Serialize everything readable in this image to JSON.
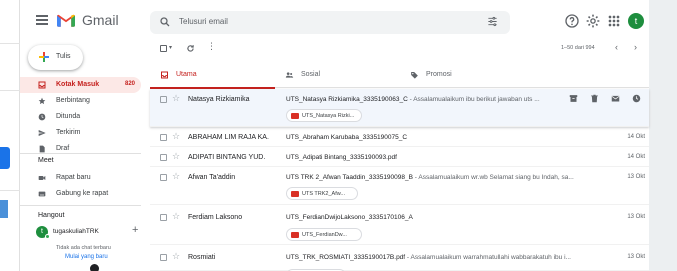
{
  "header": {
    "app_name": "Gmail",
    "search_placeholder": "Telusuri email",
    "avatar_letter": "t",
    "colors": {
      "avatar": "#1e8e3e",
      "accent": "#c5221f"
    }
  },
  "sidebar": {
    "compose_label": "Tulis",
    "items": [
      {
        "label": "Kotak Masuk",
        "count": "820",
        "icon": "inbox-icon",
        "active": true
      },
      {
        "label": "Berbintang",
        "icon": "star-icon"
      },
      {
        "label": "Ditunda",
        "icon": "clock-icon"
      },
      {
        "label": "Terkirim",
        "icon": "send-icon"
      },
      {
        "label": "Draf",
        "icon": "draft-icon"
      }
    ],
    "meet": {
      "title": "Meet",
      "items": [
        {
          "label": "Rapat baru",
          "icon": "video-icon"
        },
        {
          "label": "Gabung ke rapat",
          "icon": "keyboard-icon"
        }
      ]
    },
    "hangouts": {
      "title": "Hangout",
      "user": "tugaskuliahTRK",
      "user_letter": "t",
      "empty_text": "Tidak ada chat terbaru",
      "link_text": "Mulai yang baru"
    }
  },
  "toolbar": {
    "pagination": "1–50 dari 994"
  },
  "tabs": [
    {
      "label": "Utama",
      "icon": "inbox-icon",
      "active": true
    },
    {
      "label": "Sosial",
      "icon": "people-icon"
    },
    {
      "label": "Promosi",
      "icon": "tag-icon"
    }
  ],
  "emails": [
    {
      "sender": "Natasya Rizkiamika",
      "subject": "UTS_Natasya Rizkiamika_3335190063_C",
      "snippet": "- Assalamualaikum ibu berikut jawaban uts ...",
      "attachment": "UTS_Natasya Rizki...",
      "date": "",
      "hover": true
    },
    {
      "sender": "ABRAHAM LIM RAJA KA.",
      "subject": "UTS_Abraham Karubaba_3335190075_C",
      "snippet": "",
      "attachment": "",
      "date": "14 Okt"
    },
    {
      "sender": "ADIPATI BINTANG YUD.",
      "subject": "UTS_Adipati Bintang_3335190093.pdf",
      "snippet": "",
      "attachment": "",
      "date": "14 Okt"
    },
    {
      "sender": "Afwan Ta'addin",
      "subject": "UTS TRK 2_Afwan Taaddin_3335190098_B",
      "snippet": "- Assalamualaikum wr.wb Selamat siang bu Indah, sa...",
      "attachment": "UTS TRK2_Afw...",
      "date": "13 Okt"
    },
    {
      "sender": "Ferdiam Laksono",
      "subject": "UTS_FerdianDwijoLaksono_3335170106_A",
      "snippet": "",
      "attachment": "UTS_FerdianDw...",
      "date": "13 Okt"
    },
    {
      "sender": "Rosmiati",
      "subject": "UTS_TRK_ROSMIATI_3335190017B.pdf",
      "snippet": "- Assalamualaikum warrahmatullahi wabbarakatuh ibu i...",
      "attachment": "",
      "date": "13 Okt"
    }
  ]
}
